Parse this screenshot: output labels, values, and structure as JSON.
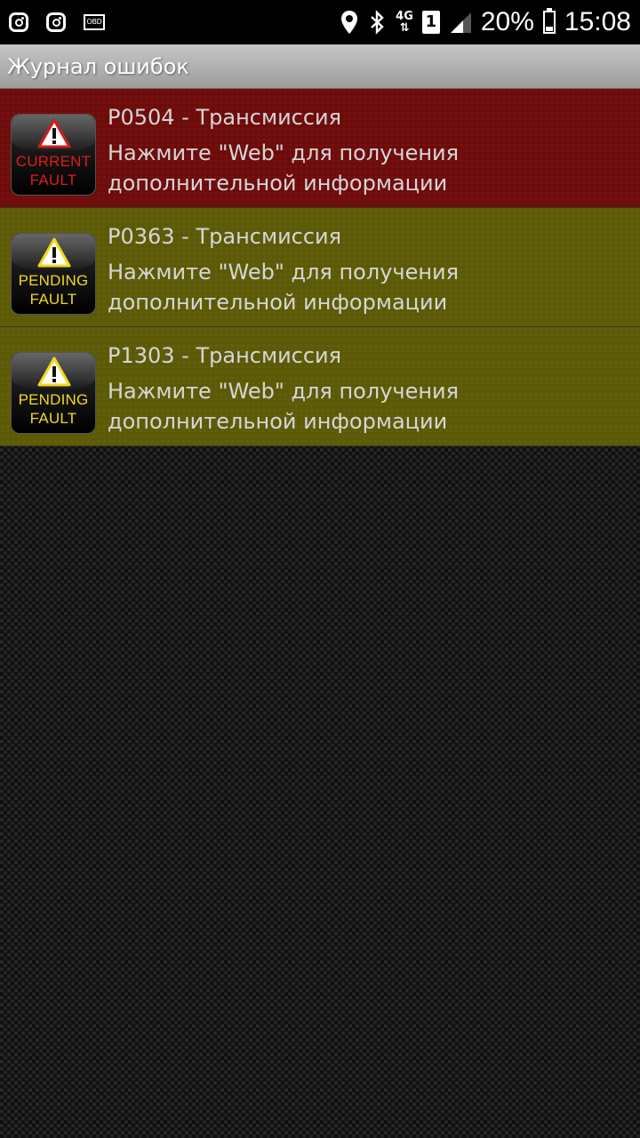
{
  "status_bar": {
    "left_icons": [
      "instagram-icon",
      "instagram-icon",
      "obd-icon"
    ],
    "obd_label": "OBD",
    "network": "4G",
    "sim_slot": "1",
    "battery_percent": "20%",
    "battery_level": 0.2,
    "time": "15:08"
  },
  "action_bar": {
    "title": "Журнал ошибок"
  },
  "faults": [
    {
      "type": "current",
      "badge_line1": "CURRENT",
      "badge_line2": "FAULT",
      "code": "P0504 - Трансмиссия",
      "description": "Нажмите \"Web\" для получения дополнительной информации",
      "color": "#6e0b0b"
    },
    {
      "type": "pending",
      "badge_line1": "PENDING",
      "badge_line2": "FAULT",
      "code": "P0363 - Трансмиссия",
      "description": "Нажмите \"Web\" для получения дополнительной информации",
      "color": "#5c5a06"
    },
    {
      "type": "pending",
      "badge_line1": "PENDING",
      "badge_line2": "FAULT",
      "code": "P1303 - Трансмиссия",
      "description": "Нажмите \"Web\" для получения дополнительной информации",
      "color": "#5c5a06"
    }
  ]
}
